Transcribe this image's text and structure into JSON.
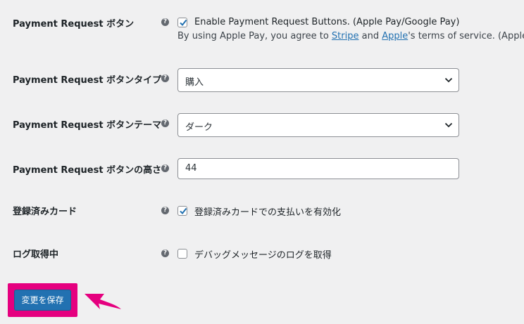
{
  "settings": {
    "payment_request": {
      "label": "Payment Request ボタン",
      "checkbox_label": "Enable Payment Request Buttons. (Apple Pay/Google Pay)",
      "checked": true,
      "desc_before": "By using Apple Pay, you agree to ",
      "desc_link1": "Stripe",
      "desc_mid": " and ",
      "desc_link2": "Apple",
      "desc_after": "'s terms of service. (Apple Pay"
    },
    "button_type": {
      "label": "Payment Request ボタンタイプ",
      "value": "購入"
    },
    "button_theme": {
      "label": "Payment Request ボタンテーマ",
      "value": "ダーク"
    },
    "button_height": {
      "label": "Payment Request ボタンの高さ",
      "value": "44"
    },
    "saved_cards": {
      "label": "登録済みカード",
      "checkbox_label": "登録済みカードでの支払いを有効化",
      "checked": true
    },
    "logging": {
      "label": "ログ取得中",
      "checkbox_label": "デバッグメッセージのログを取得",
      "checked": false
    }
  },
  "help_glyph": "?",
  "save_button": {
    "label": "変更を保存",
    "highlight_color": "#e5007f"
  },
  "colors": {
    "accent": "#2271b1",
    "highlight": "#e5007f"
  }
}
